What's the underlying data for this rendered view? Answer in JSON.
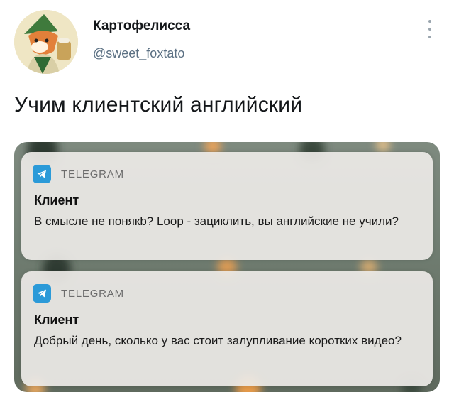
{
  "tweet": {
    "author_name": "Картофелисса",
    "author_handle": "@sweet_foxtato",
    "text": "Учим клиентский английский"
  },
  "icons": [
    "more-vertical-icon",
    "telegram-icon"
  ],
  "colors": {
    "telegram_blue": "#2b9ad8",
    "handle_gray": "#5b7083",
    "notification_bg": "#ecebe6"
  },
  "notifications": [
    {
      "app": "TELEGRAM",
      "title": "Клиент",
      "body": "В смысле не понякb? Loop - зациклить, вы английские не учили?"
    },
    {
      "app": "TELEGRAM",
      "title": "Клиент",
      "body": "Добрый день, сколько у вас стоит залупливание коротких видео?"
    }
  ]
}
